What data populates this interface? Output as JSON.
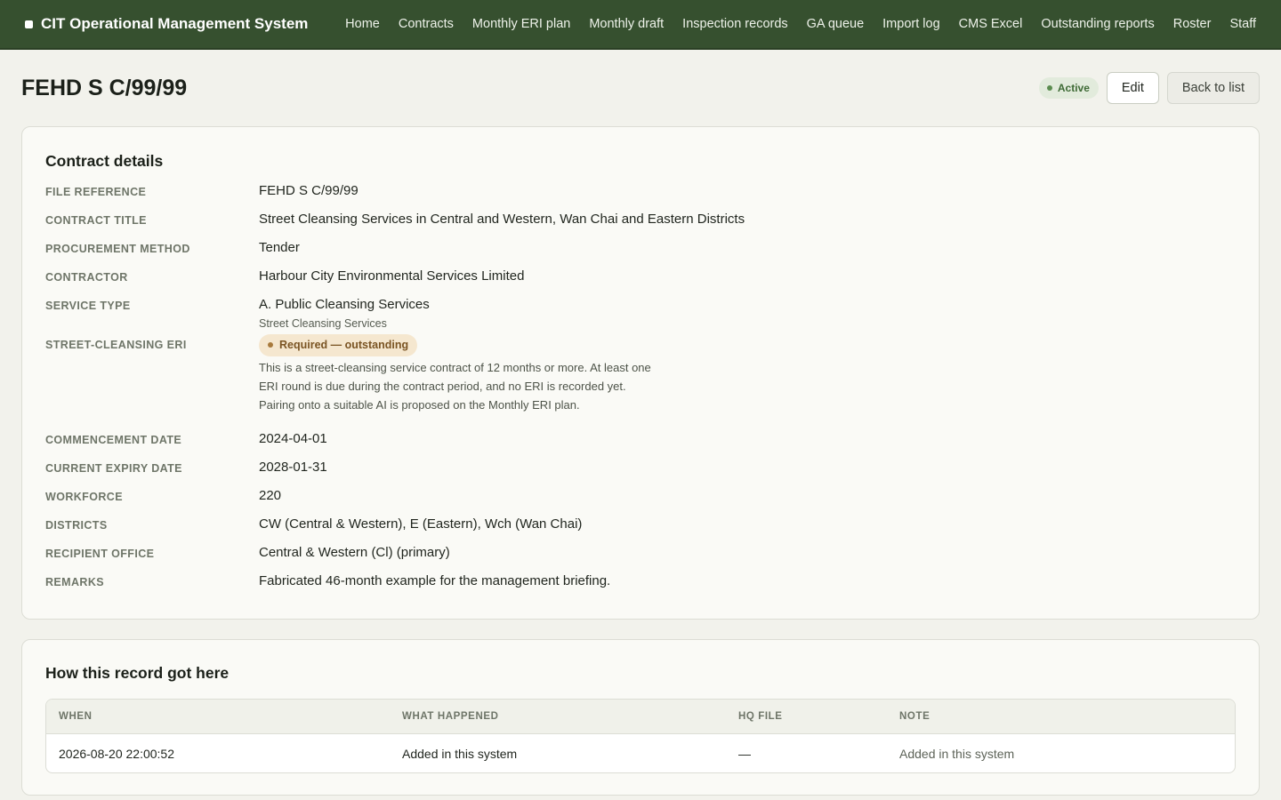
{
  "app": {
    "title": "CIT Operational Management System"
  },
  "nav": [
    {
      "id": "home",
      "label": "Home"
    },
    {
      "id": "contracts",
      "label": "Contracts"
    },
    {
      "id": "monthly-eri-plan",
      "label": "Monthly ERI plan"
    },
    {
      "id": "monthly-draft",
      "label": "Monthly draft"
    },
    {
      "id": "inspection-records",
      "label": "Inspection records"
    },
    {
      "id": "ga-queue",
      "label": "GA queue"
    },
    {
      "id": "import-log",
      "label": "Import log"
    },
    {
      "id": "cms-excel",
      "label": "CMS Excel"
    },
    {
      "id": "outstanding-reports",
      "label": "Outstanding reports"
    },
    {
      "id": "roster",
      "label": "Roster"
    },
    {
      "id": "staff",
      "label": "Staff"
    }
  ],
  "page": {
    "title": "FEHD S C/99/99",
    "status": "Active",
    "status_color": "#5b8c4f",
    "edit_label": "Edit",
    "back_label": "Back to list"
  },
  "details": {
    "title": "Contract details",
    "file_reference": {
      "label": "File reference",
      "value": "FEHD S C/99/99"
    },
    "contract_title": {
      "label": "Contract title",
      "value": "Street Cleansing Services in Central and Western, Wan Chai and Eastern Districts"
    },
    "procurement_method": {
      "label": "Procurement method",
      "value": "Tender"
    },
    "contractor": {
      "label": "Contractor",
      "value": "Harbour City Environmental Services Limited"
    },
    "service_type": {
      "label": "Service type",
      "value": "A. Public Cleansing Services",
      "sub": "Street Cleansing Services"
    },
    "eri": {
      "label": "Street-cleansing ERI",
      "badge": "Required — outstanding",
      "badge_color": "#a87a3c",
      "note": "This is a street-cleansing service contract of 12 months or more. At least one ERI round is due during the contract period, and no ERI is recorded yet. Pairing onto a suitable AI is proposed on the Monthly ERI plan."
    },
    "commencement_date": {
      "label": "Commencement date",
      "value": "2024-04-01"
    },
    "current_expiry_date": {
      "label": "Current expiry date",
      "value": "2028-01-31"
    },
    "workforce": {
      "label": "Workforce",
      "value": "220"
    },
    "districts": {
      "label": "Districts",
      "value": "CW (Central & Western), E (Eastern), Wch (Wan Chai)"
    },
    "recipient_office": {
      "label": "Recipient office",
      "value": "Central & Western (Cl) (primary)"
    },
    "remarks": {
      "label": "Remarks",
      "value": "Fabricated 46-month example for the management briefing."
    }
  },
  "history": {
    "title": "How this record got here",
    "columns": {
      "when": "When",
      "what": "What happened",
      "hq_file": "HQ file",
      "note": "Note"
    },
    "rows": [
      {
        "when": "2026-08-20 22:00:52",
        "what": "Added in this system",
        "hq_file": "—",
        "note": "Added in this system"
      }
    ]
  }
}
